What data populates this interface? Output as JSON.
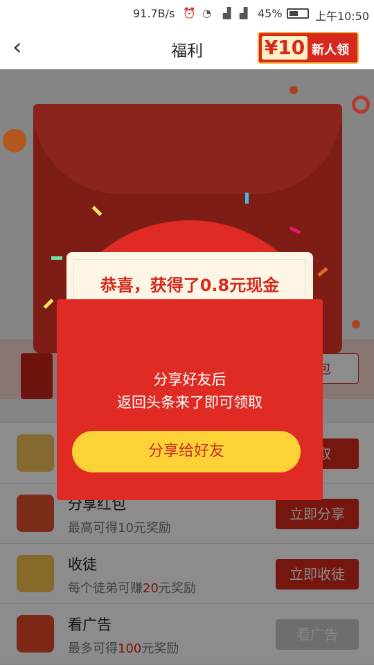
{
  "status_bar": {
    "speed": "91.7B/s",
    "icons": [
      "alarm-icon",
      "wifi-icon",
      "signal-icon",
      "signal-icon",
      "battery-icon"
    ],
    "battery": "45%",
    "time": "上午10:50"
  },
  "nav": {
    "title": "福利",
    "badge_amount": "¥10",
    "badge_label": "新人领"
  },
  "banner": {
    "button_label": "红包"
  },
  "rows": [
    {
      "title": "",
      "subtitle": "",
      "button": "领取"
    },
    {
      "title": "分享红包",
      "subtitle": "最高可得10元奖励",
      "button": "立即分享"
    },
    {
      "title": "收徒",
      "subtitle_pre": "每个徒弟可赚",
      "subtitle_amt": "20",
      "subtitle_post": "元奖励",
      "button": "立即收徒"
    },
    {
      "title": "看广告",
      "subtitle_pre": "最多可得",
      "subtitle_amt": "100",
      "subtitle_post": "元奖励",
      "button": "看广告"
    }
  ],
  "popup": {
    "headline": "恭喜，获得了0.8元现金",
    "line1": "分享好友后",
    "line2": "返回头条来了即可领取",
    "share_button": "分享给好友"
  },
  "colors": {
    "accent_red": "#d6281c",
    "button_yellow": "#fdd237",
    "letter_cream": "#fdf6e6"
  }
}
